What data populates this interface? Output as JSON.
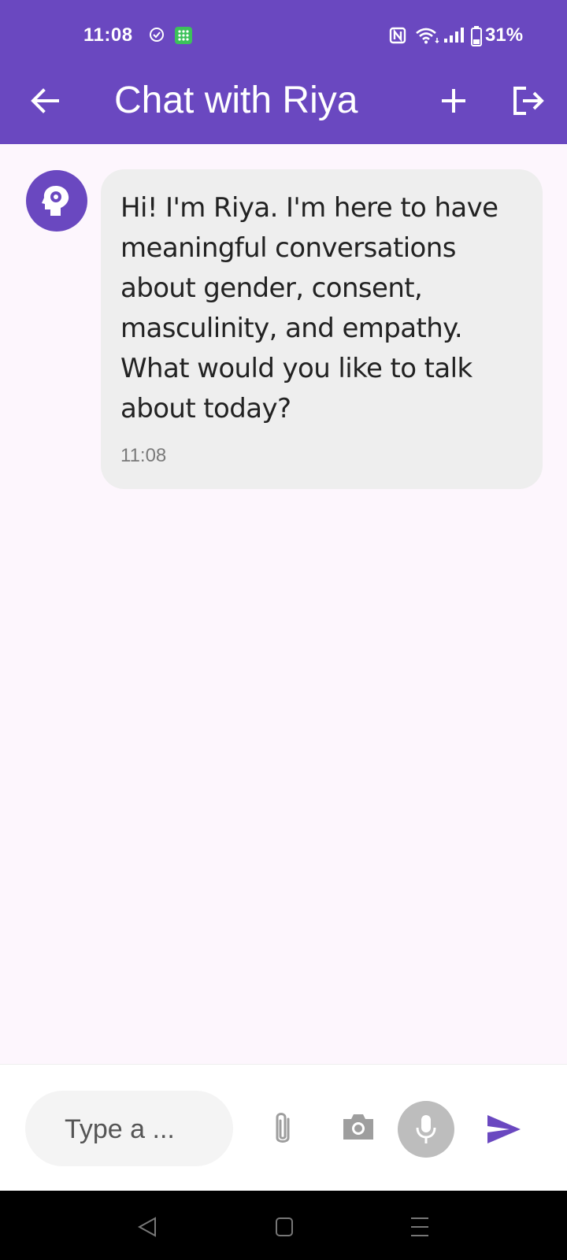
{
  "status_bar": {
    "time": "11:08",
    "battery": "31%"
  },
  "header": {
    "title": "Chat with Riya",
    "icons": {
      "back": "arrow-left-icon",
      "new_chat": "plus-icon",
      "logout": "logout-icon"
    }
  },
  "messages": [
    {
      "sender_icon": "psychology-head-icon",
      "text": "Hi! I'm Riya. I'm here to have meaningful conversations about gender, consent, masculinity, and empathy. What would you like to talk about today?",
      "time": "11:08"
    }
  ],
  "composer": {
    "placeholder": "Type a ...",
    "icons": [
      "paperclip-icon",
      "camera-icon",
      "microphone-icon",
      "send-icon"
    ]
  },
  "colors": {
    "primary": "#6a48c0",
    "background": "#fdf6fd",
    "bubble": "#eeeeee",
    "mic_button": "#bdbdbd"
  }
}
